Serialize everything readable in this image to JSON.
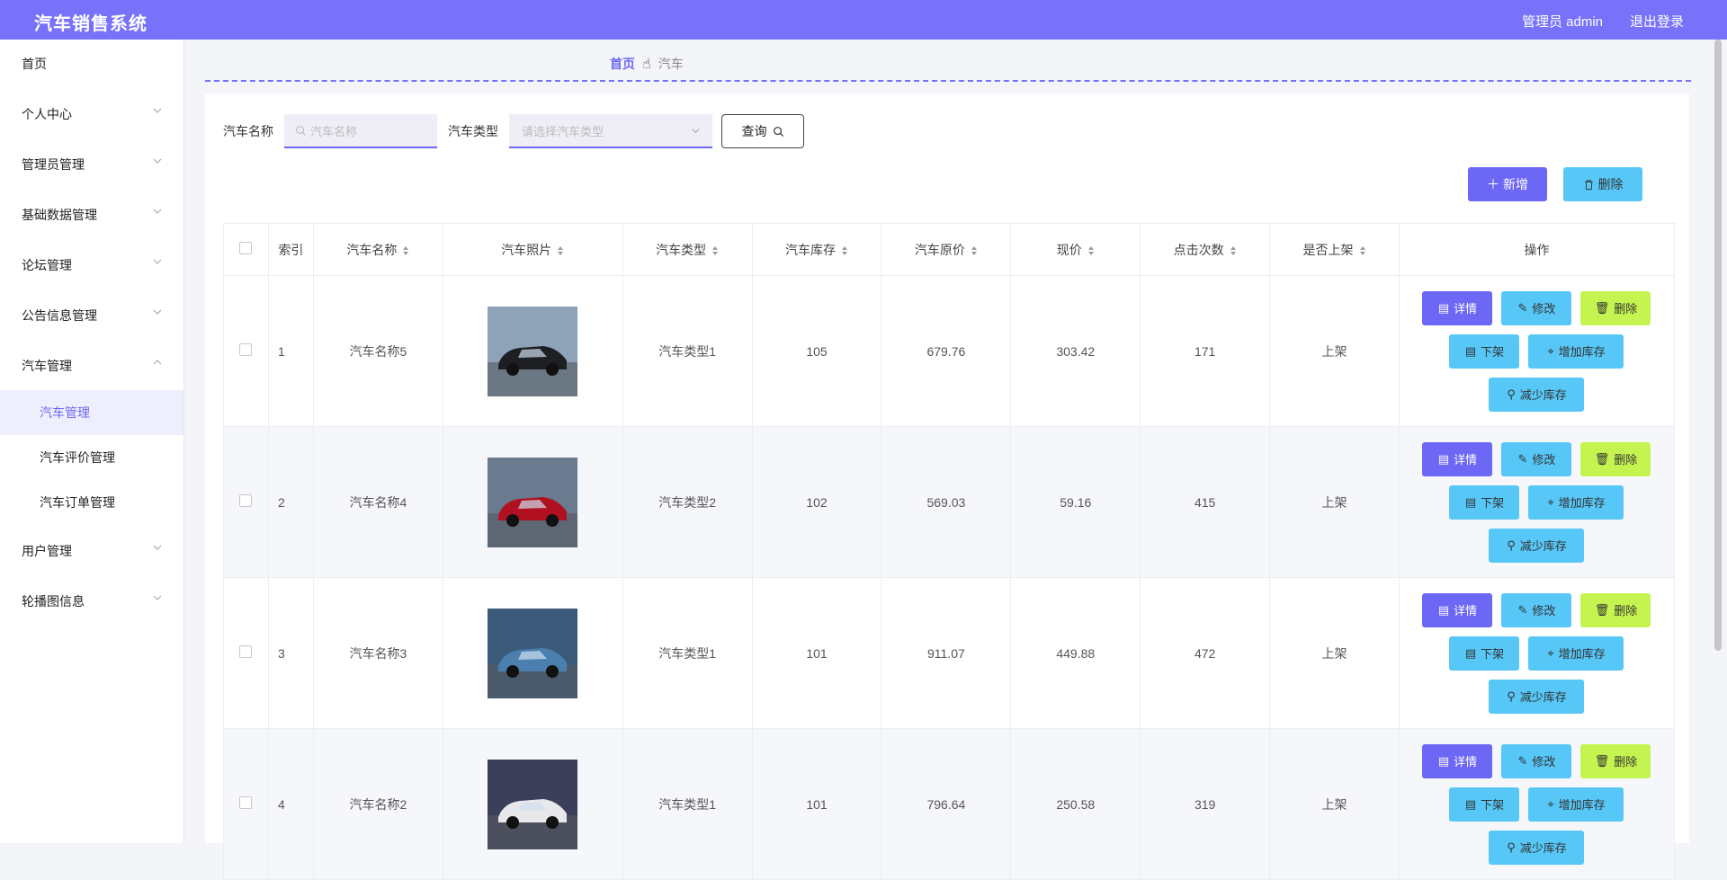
{
  "header": {
    "title": "汽车销售系统",
    "admin": "管理员 admin",
    "logout": "退出登录"
  },
  "sidebar": {
    "items": [
      {
        "label": "首页",
        "chevron": false
      },
      {
        "label": "个人中心",
        "chevron": "down"
      },
      {
        "label": "管理员管理",
        "chevron": "down"
      },
      {
        "label": "基础数据管理",
        "chevron": "down"
      },
      {
        "label": "论坛管理",
        "chevron": "down"
      },
      {
        "label": "公告信息管理",
        "chevron": "down"
      },
      {
        "label": "汽车管理",
        "chevron": "up"
      },
      {
        "label": "汽车管理",
        "sub": true,
        "active": true
      },
      {
        "label": "汽车评价管理",
        "sub": true
      },
      {
        "label": "汽车订单管理",
        "sub": true
      },
      {
        "label": "用户管理",
        "chevron": "down"
      },
      {
        "label": "轮播图信息",
        "chevron": "down"
      }
    ]
  },
  "breadcrumb": {
    "home": "首页",
    "current": "汽车",
    "separator_icon": "hand-icon"
  },
  "search": {
    "name_label": "汽车名称",
    "name_placeholder": "汽车名称",
    "type_label": "汽车类型",
    "type_placeholder": "请选择汽车类型",
    "query_label": "查询"
  },
  "toolbar": {
    "add_label": "新增",
    "delete_label": "删除"
  },
  "table": {
    "headers": [
      "索引",
      "汽车名称",
      "汽车照片",
      "汽车类型",
      "汽车库存",
      "汽车原价",
      "现价",
      "点击次数",
      "是否上架",
      "操作"
    ],
    "rows": [
      {
        "index": "1",
        "name": "汽车名称5",
        "type": "汽车类型1",
        "stock": "105",
        "original_price": "679.76",
        "price": "303.42",
        "clicks": "171",
        "status": "上架"
      },
      {
        "index": "2",
        "name": "汽车名称4",
        "type": "汽车类型2",
        "stock": "102",
        "original_price": "569.03",
        "price": "59.16",
        "clicks": "415",
        "status": "上架"
      },
      {
        "index": "3",
        "name": "汽车名称3",
        "type": "汽车类型1",
        "stock": "101",
        "original_price": "911.07",
        "price": "449.88",
        "clicks": "472",
        "status": "上架"
      },
      {
        "index": "4",
        "name": "汽车名称2",
        "type": "汽车类型1",
        "stock": "101",
        "original_price": "796.64",
        "price": "250.58",
        "clicks": "319",
        "status": "上架"
      }
    ],
    "actions": {
      "detail": "详情",
      "edit": "修改",
      "delete": "删除",
      "off_shelf": "下架",
      "add_stock": "增加库存",
      "reduce_stock": "减少库存"
    }
  },
  "colors": {
    "primary": "#7772f9",
    "info": "#57c7f7",
    "warning": "#c5f450"
  }
}
